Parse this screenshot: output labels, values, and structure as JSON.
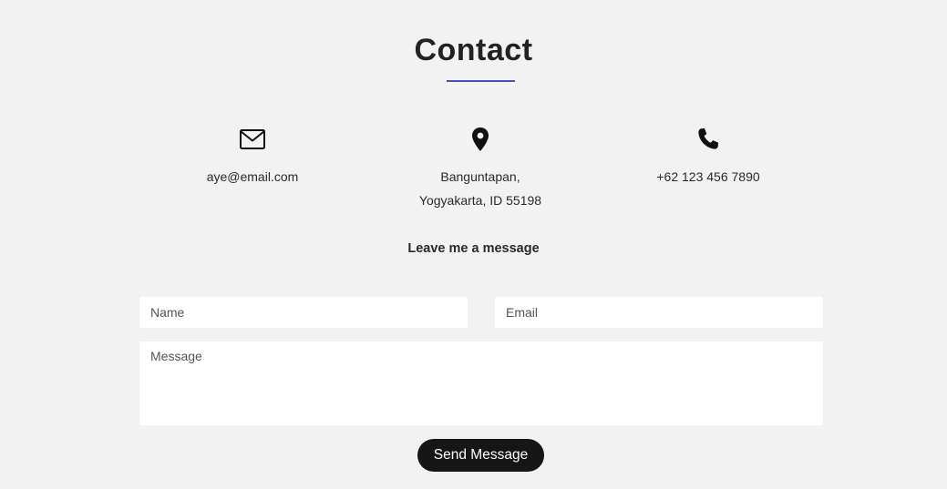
{
  "contact": {
    "title": "Contact",
    "accent_color": "#4a4ec0"
  },
  "info": {
    "email": {
      "icon": "envelope-icon",
      "text": "aye@email.com"
    },
    "address": {
      "icon": "map-pin-icon",
      "line1": "Banguntapan,",
      "line2": "Yogyakarta, ID 55198"
    },
    "phone": {
      "icon": "phone-icon",
      "text": "+62 123 456 7890"
    }
  },
  "form": {
    "heading": "Leave me a message",
    "name_placeholder": "Name",
    "email_placeholder": "Email",
    "message_placeholder": "Message",
    "submit_label": "Send Message",
    "submit_color": "#161616"
  }
}
